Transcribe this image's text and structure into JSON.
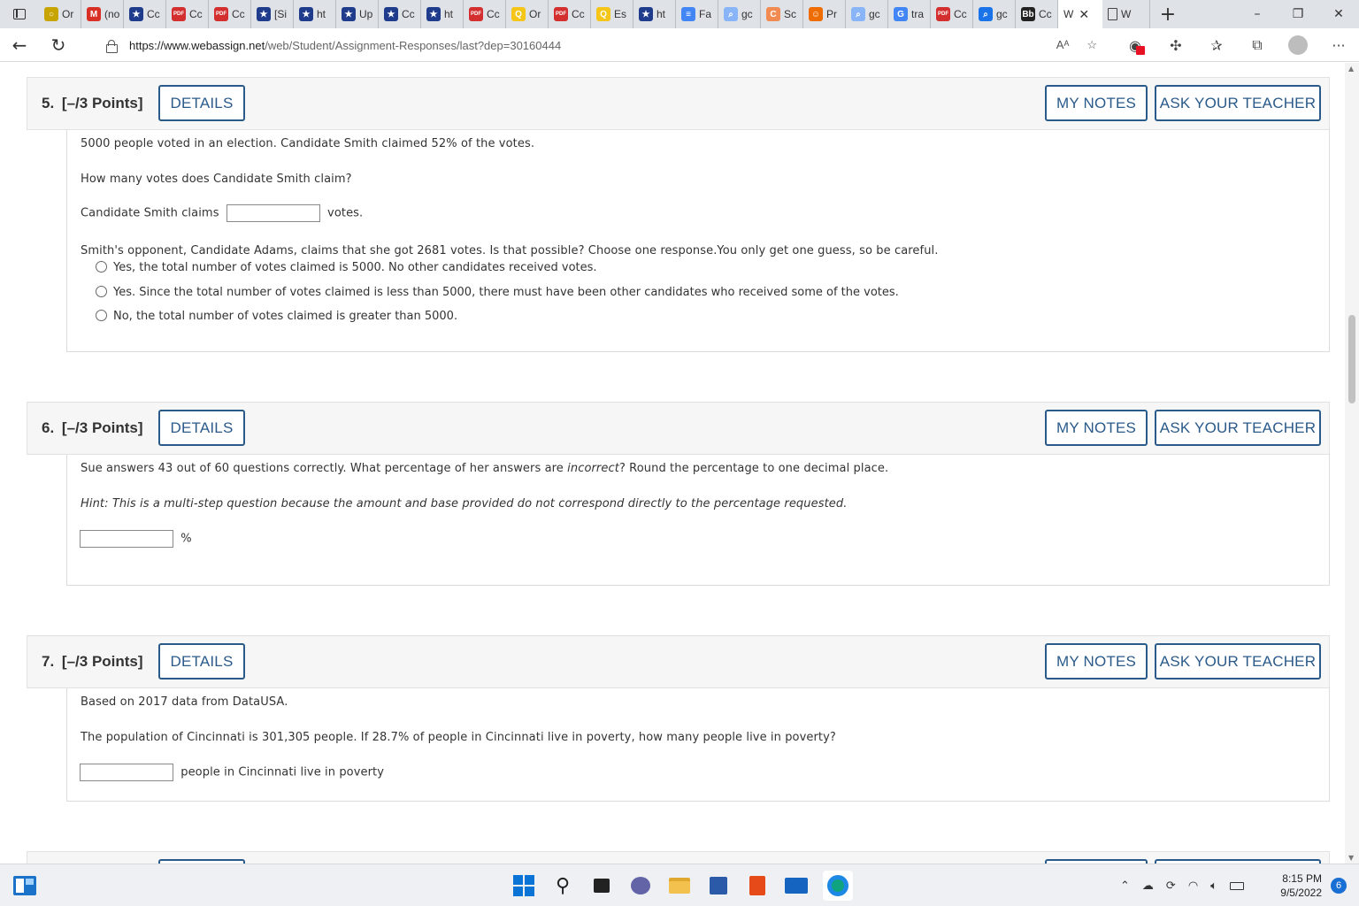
{
  "browser": {
    "tabs": [
      {
        "label": "Or",
        "color": "#c8a400",
        "glyph": "○"
      },
      {
        "label": "(no",
        "color": "#d93025",
        "glyph": "M"
      },
      {
        "label": "Cc",
        "color": "#1f3b8c",
        "glyph": "★"
      },
      {
        "label": "Cc",
        "color": "#d32f2f",
        "glyph": "PDF"
      },
      {
        "label": "Cc",
        "color": "#d32f2f",
        "glyph": "PDF"
      },
      {
        "label": "[Si",
        "color": "#1f3b8c",
        "glyph": "★"
      },
      {
        "label": "ht",
        "color": "#1f3b8c",
        "glyph": "★"
      },
      {
        "label": "Up",
        "color": "#1f3b8c",
        "glyph": "★"
      },
      {
        "label": "Cc",
        "color": "#1f3b8c",
        "glyph": "★"
      },
      {
        "label": "ht",
        "color": "#1f3b8c",
        "glyph": "★"
      },
      {
        "label": "Cc",
        "color": "#d32f2f",
        "glyph": "PDF"
      },
      {
        "label": "Or",
        "color": "#f5c518",
        "glyph": "Q"
      },
      {
        "label": "Cc",
        "color": "#d32f2f",
        "glyph": "PDF"
      },
      {
        "label": "Es",
        "color": "#f5c518",
        "glyph": "Q"
      },
      {
        "label": "ht",
        "color": "#1f3b8c",
        "glyph": "★"
      },
      {
        "label": "Fa",
        "color": "#4285f4",
        "glyph": "≡"
      },
      {
        "label": "gc",
        "color": "#8ab4f8",
        "glyph": "⌕"
      },
      {
        "label": "Sc",
        "color": "#f28b52",
        "glyph": "C"
      },
      {
        "label": "Pr",
        "color": "#ef6c00",
        "glyph": "☺"
      },
      {
        "label": "gc",
        "color": "#8ab4f8",
        "glyph": "⌕"
      },
      {
        "label": "tra",
        "color": "#4285f4",
        "glyph": "G"
      },
      {
        "label": "Cc",
        "color": "#d32f2f",
        "glyph": "PDF"
      },
      {
        "label": "gc",
        "color": "#1a73e8",
        "glyph": "⌕"
      },
      {
        "label": "Cc",
        "color": "#222222",
        "glyph": "Bb"
      }
    ],
    "active_tab": {
      "label": "W",
      "close": "✕"
    },
    "plain_tab": {
      "label": "W"
    },
    "new_tab": "+",
    "window_controls": {
      "minimize": "–",
      "restore": "❐",
      "close": "✕"
    },
    "url_host": "https://www.webassign.net",
    "url_path": "/web/Student/Assignment-Responses/last?dep=30160444",
    "read_aloud": "Aᴬ",
    "favorite": "☆"
  },
  "questions": [
    {
      "number": "5.",
      "points": "[–/3 Points]",
      "details_label": "DETAILS",
      "notes_label": "MY NOTES",
      "ask_label": "ASK YOUR TEACHER",
      "intro": "5000 people voted in an election. Candidate Smith claimed 52% of the votes.",
      "question": "How many votes does Candidate Smith claim?",
      "answer_prefix": "Candidate Smith claims",
      "answer_suffix": "votes.",
      "followup": "Smith's opponent, Candidate Adams, claims that she got 2681 votes. Is that possible? Choose one response.You only get one guess, so be careful.",
      "options": [
        "Yes, the total number of votes claimed is 5000. No other candidates received votes.",
        "Yes. Since the total number of votes claimed is less than 5000, there must have been other candidates who received some of the votes.",
        "No, the total number of votes claimed is greater than 5000."
      ]
    },
    {
      "number": "6.",
      "points": "[–/3 Points]",
      "details_label": "DETAILS",
      "notes_label": "MY NOTES",
      "ask_label": "ASK YOUR TEACHER",
      "question_pre": "Sue answers 43 out of 60 questions correctly. What percentage of her answers are ",
      "question_em": "incorrect",
      "question_post": "? Round the percentage to one decimal place.",
      "hint": "Hint: This is a multi-step question because the amount and base provided do not correspond directly to the percentage requested.",
      "answer_suffix": "%"
    },
    {
      "number": "7.",
      "points": "[–/3 Points]",
      "details_label": "DETAILS",
      "notes_label": "MY NOTES",
      "ask_label": "ASK YOUR TEACHER",
      "source": "Based on 2017 data from DataUSA.",
      "question": "The population of Cincinnati is 301,305 people. If 28.7% of people in Cincinnati live in poverty, how many people live in poverty?",
      "answer_suffix": "people in Cincinnati live in poverty"
    }
  ],
  "taskbar": {
    "time": "8:15 PM",
    "date": "9/5/2022",
    "notifications": "6"
  }
}
